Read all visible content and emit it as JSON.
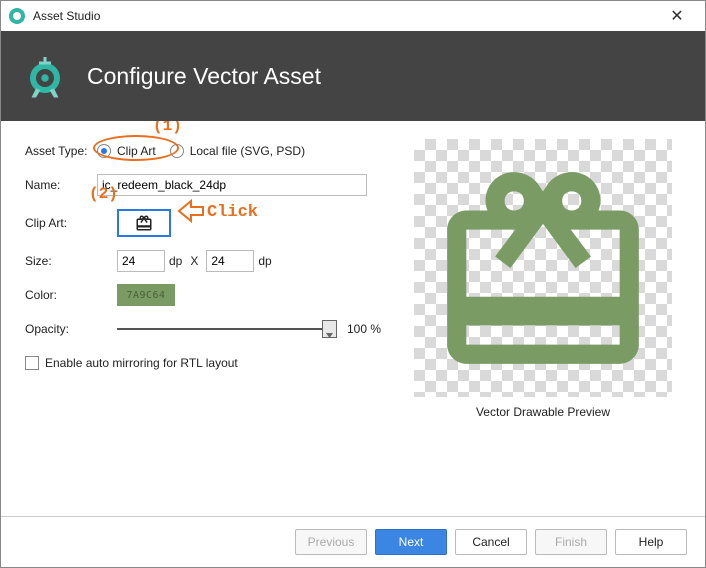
{
  "window": {
    "title": "Asset Studio"
  },
  "header": {
    "title": "Configure Vector Asset"
  },
  "form": {
    "asset_type_label": "Asset Type:",
    "asset_type": {
      "clip_art": "Clip Art",
      "local_file": "Local file (SVG, PSD)",
      "selected": "clip_art"
    },
    "name_label": "Name:",
    "name_value": "ic_redeem_black_24dp",
    "clipart_label": "Clip Art:",
    "clipart_icon": "redeem-icon",
    "size_label": "Size:",
    "size_w": "24",
    "size_h": "24",
    "size_unit": "dp",
    "size_sep": "X",
    "color_label": "Color:",
    "color_hex": "7A9C64",
    "opacity_label": "Opacity:",
    "opacity_value": 100,
    "opacity_text": "100 %",
    "rtl_label": "Enable auto mirroring for RTL layout",
    "rtl_checked": false
  },
  "preview": {
    "label": "Vector Drawable Preview"
  },
  "footer": {
    "previous": "Previous",
    "next": "Next",
    "cancel": "Cancel",
    "finish": "Finish",
    "help": "Help"
  },
  "annotations": {
    "n1": "(1)",
    "n2": "(2)",
    "click": "Click"
  }
}
